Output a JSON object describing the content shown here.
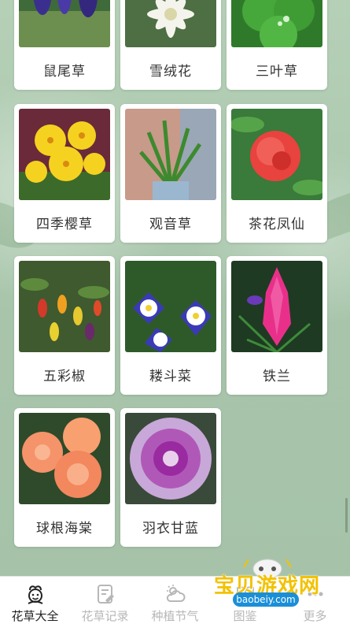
{
  "plants": [
    {
      "name": "鼠尾草",
      "icon": "sage-photo"
    },
    {
      "name": "雪绒花",
      "icon": "edelweiss-photo"
    },
    {
      "name": "三叶草",
      "icon": "clover-photo"
    },
    {
      "name": "四季樱草",
      "icon": "primrose-photo"
    },
    {
      "name": "观音草",
      "icon": "guanyin-grass-photo"
    },
    {
      "name": "茶花凤仙",
      "icon": "camellia-balsam-photo"
    },
    {
      "name": "五彩椒",
      "icon": "ornamental-pepper-photo"
    },
    {
      "name": "耧斗菜",
      "icon": "columbine-photo"
    },
    {
      "name": "铁兰",
      "icon": "tillandsia-photo"
    },
    {
      "name": "球根海棠",
      "icon": "tuberous-begonia-photo"
    },
    {
      "name": "羽衣甘蓝",
      "icon": "ornamental-kale-photo"
    }
  ],
  "tabbar": {
    "tabs": [
      {
        "label": "花草大全",
        "icon": "flower-face-icon",
        "active": true
      },
      {
        "label": "花草记录",
        "icon": "notebook-edit-icon",
        "active": false
      },
      {
        "label": "种植节气",
        "icon": "weather-cloud-icon",
        "active": false
      },
      {
        "label": "图鉴",
        "icon": "book-icon",
        "active": false
      },
      {
        "label": "更多",
        "icon": "more-icon",
        "active": false
      }
    ]
  },
  "watermark": {
    "text": "宝贝游戏网",
    "url": "baobeiy.com"
  },
  "colors": {
    "active_tab": "#222222",
    "inactive_tab": "#b7b7b7",
    "background": "#a9c6ad"
  }
}
